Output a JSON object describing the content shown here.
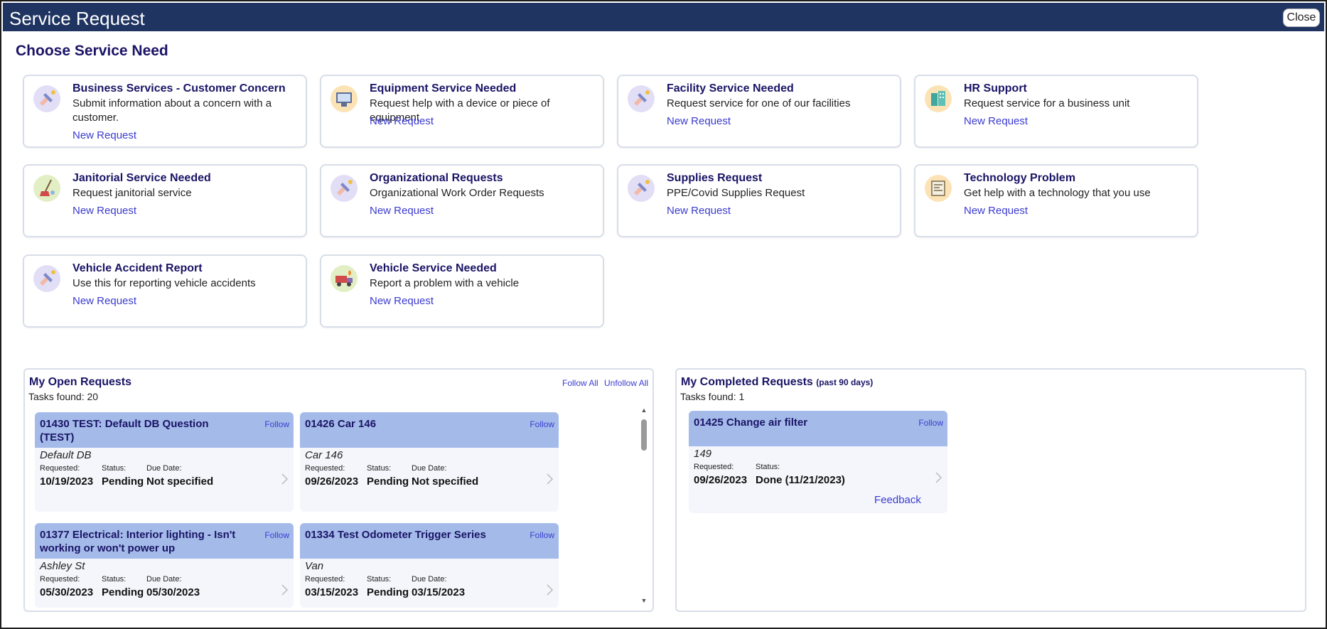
{
  "window": {
    "title": "Service Request",
    "close_label": "Close"
  },
  "section_title": "Choose Service Need",
  "services": [
    {
      "title": "Business Services - Customer Concern",
      "description": "Submit information about a concern with a customer.",
      "link": "New Request",
      "icon": "wrench-hand-icon"
    },
    {
      "title": "Equipment Service Needed",
      "description": "Request help with a device or piece of equipment",
      "link": "New Request",
      "icon": "monitor-icon"
    },
    {
      "title": "Facility Service Needed",
      "description": "Request service for one of our facilities",
      "link": "New Request",
      "icon": "wrench-hand-icon"
    },
    {
      "title": "HR Support",
      "description": "Request service for a business unit",
      "link": "New Request",
      "icon": "building-icon"
    },
    {
      "title": "Janitorial Service Needed",
      "description": "Request janitorial service",
      "link": "New Request",
      "icon": "broom-icon"
    },
    {
      "title": "Organizational Requests",
      "description": "Organizational Work Order Requests",
      "link": "New Request",
      "icon": "wrench-hand-icon"
    },
    {
      "title": "Supplies Request",
      "description": "PPE/Covid Supplies Request",
      "link": "New Request",
      "icon": "wrench-hand-icon"
    },
    {
      "title": "Technology Problem",
      "description": "Get help with a technology that you use",
      "link": "New Request",
      "icon": "circuit-icon"
    },
    {
      "title": "Vehicle Accident Report",
      "description": "Use this for reporting vehicle accidents",
      "link": "New Request",
      "icon": "wrench-hand-icon"
    },
    {
      "title": "Vehicle Service Needed",
      "description": "Report a problem with a vehicle",
      "link": "New Request",
      "icon": "truck-icon"
    }
  ],
  "open_requests": {
    "title": "My Open Requests",
    "count_text": "Tasks found: 20",
    "follow_all": "Follow All",
    "unfollow_all": "Unfollow All",
    "items": [
      {
        "title": "01430 TEST: Default DB Question (TEST)",
        "follow": "Follow",
        "subtitle": "Default DB",
        "requested_label": "Requested:",
        "requested": "10/19/2023",
        "status_label": "Status:",
        "status": "Pending",
        "due_label": "Due Date:",
        "due": "Not specified"
      },
      {
        "title": "01426 Car 146",
        "follow": "Follow",
        "subtitle": "Car 146",
        "requested_label": "Requested:",
        "requested": "09/26/2023",
        "status_label": "Status:",
        "status": "Pending",
        "due_label": "Due Date:",
        "due": "Not specified"
      },
      {
        "title": "01377 Electrical: Interior lighting - Isn't working or won't power up",
        "follow": "Follow",
        "subtitle": "Ashley St",
        "requested_label": "Requested:",
        "requested": "05/30/2023",
        "status_label": "Status:",
        "status": "Pending",
        "due_label": "Due Date:",
        "due": "05/30/2023"
      },
      {
        "title": "01334 Test Odometer Trigger Series",
        "follow": "Follow",
        "subtitle": "Van",
        "requested_label": "Requested:",
        "requested": "03/15/2023",
        "status_label": "Status:",
        "status": "Pending",
        "due_label": "Due Date:",
        "due": "03/15/2023"
      }
    ]
  },
  "completed_requests": {
    "title": "My Completed Requests",
    "title_suffix": "(past 90 days)",
    "count_text": "Tasks found: 1",
    "items": [
      {
        "title": "01425 Change air filter",
        "follow": "Follow",
        "subtitle": "149",
        "requested_label": "Requested:",
        "requested": "09/26/2023",
        "status_label": "Status:",
        "status": "Done (11/21/2023)",
        "feedback": "Feedback"
      }
    ]
  }
}
